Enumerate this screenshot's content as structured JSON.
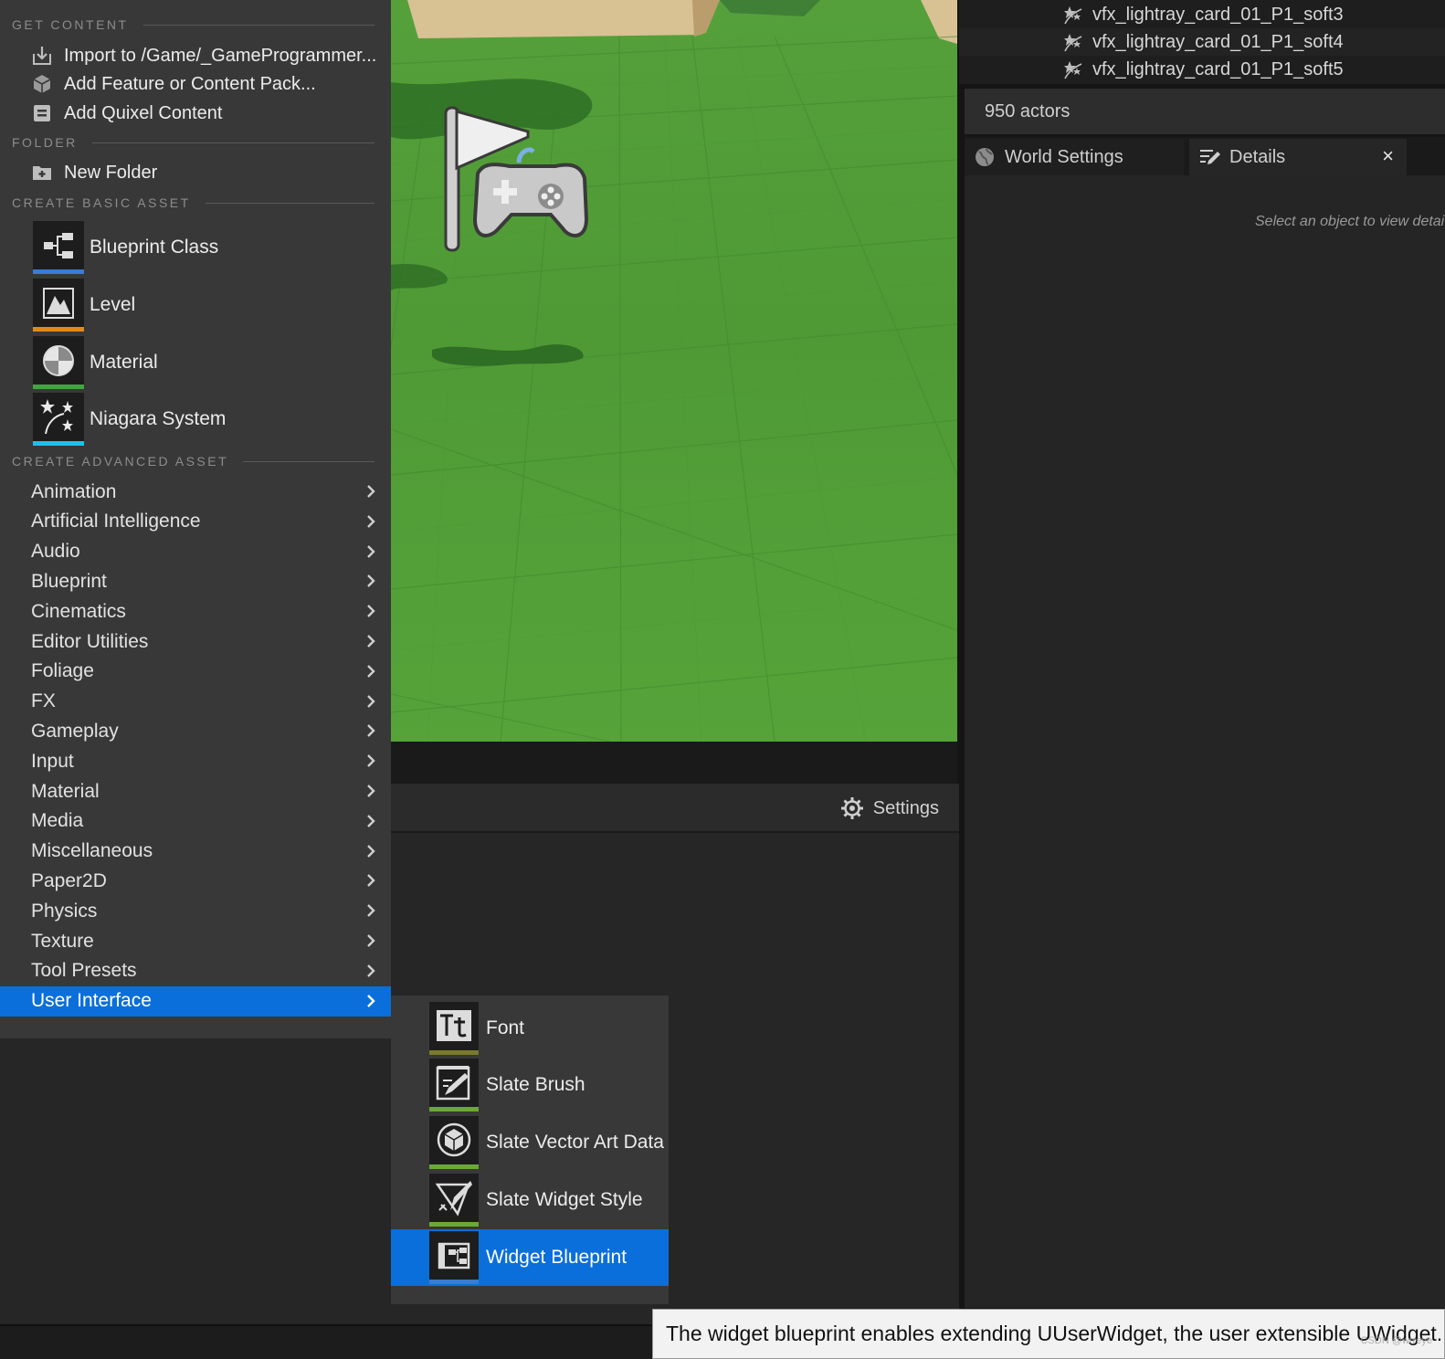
{
  "outliner": {
    "rows": [
      {
        "label": "vfx_lightray_card_01_P1_soft3"
      },
      {
        "label": "vfx_lightray_card_01_P1_soft4"
      },
      {
        "label": "vfx_lightray_card_01_P1_soft5"
      }
    ],
    "actor_count": "950 actors"
  },
  "right_tabs": {
    "world_settings": "World Settings",
    "details": "Details",
    "close": "×"
  },
  "details": {
    "hint": "Select an object to view detai"
  },
  "viewport_toolbar": {
    "settings_label": "Settings"
  },
  "menu": {
    "sections": {
      "get_content": "GET CONTENT",
      "folder": "FOLDER",
      "create_basic": "CREATE BASIC ASSET",
      "create_advanced": "CREATE ADVANCED ASSET"
    },
    "get_content_items": [
      {
        "label": "Import to /Game/_GameProgrammer...",
        "icon": "import-icon"
      },
      {
        "label": "Add Feature or Content Pack...",
        "icon": "content-pack-icon"
      },
      {
        "label": "Add Quixel Content",
        "icon": "quixel-icon"
      }
    ],
    "folder_items": [
      {
        "label": "New Folder",
        "icon": "new-folder-icon"
      }
    ],
    "basic_assets": [
      {
        "label": "Blueprint Class",
        "icon": "blueprint-class-icon",
        "color": "#3a7bd5"
      },
      {
        "label": "Level",
        "icon": "level-icon",
        "color": "#e08a1e"
      },
      {
        "label": "Material",
        "icon": "material-icon",
        "color": "#3fa83a"
      },
      {
        "label": "Niagara System",
        "icon": "niagara-icon",
        "color": "#1ec1e6"
      }
    ],
    "advanced_categories": [
      "Animation",
      "Artificial Intelligence",
      "Audio",
      "Blueprint",
      "Cinematics",
      "Editor Utilities",
      "Foliage",
      "FX",
      "Gameplay",
      "Input",
      "Material",
      "Media",
      "Miscellaneous",
      "Paper2D",
      "Physics",
      "Texture",
      "Tool Presets",
      "User Interface"
    ],
    "selected_category": "User Interface"
  },
  "submenu": {
    "items": [
      {
        "label": "Font",
        "icon": "font-icon",
        "color": "#7a7a2a"
      },
      {
        "label": "Slate Brush",
        "icon": "slate-brush-icon",
        "color": "#6aa83a"
      },
      {
        "label": "Slate Vector Art Data",
        "icon": "vector-art-icon",
        "color": "#6aa83a"
      },
      {
        "label": "Slate Widget Style",
        "icon": "widget-style-icon",
        "color": "#6aa83a"
      },
      {
        "label": "Widget Blueprint",
        "icon": "widget-blueprint-icon",
        "color": "#3a7bd5"
      }
    ],
    "selected": "Widget Blueprint"
  },
  "tooltip": {
    "text": "The widget blueprint enables extending UUserWidget, the user extensible UWidget."
  },
  "watermark": "CSDN @wrreye",
  "colors": {
    "menu_bg": "#383838",
    "selection": "#0a6fda",
    "viewport_grass": "#55a03b"
  }
}
